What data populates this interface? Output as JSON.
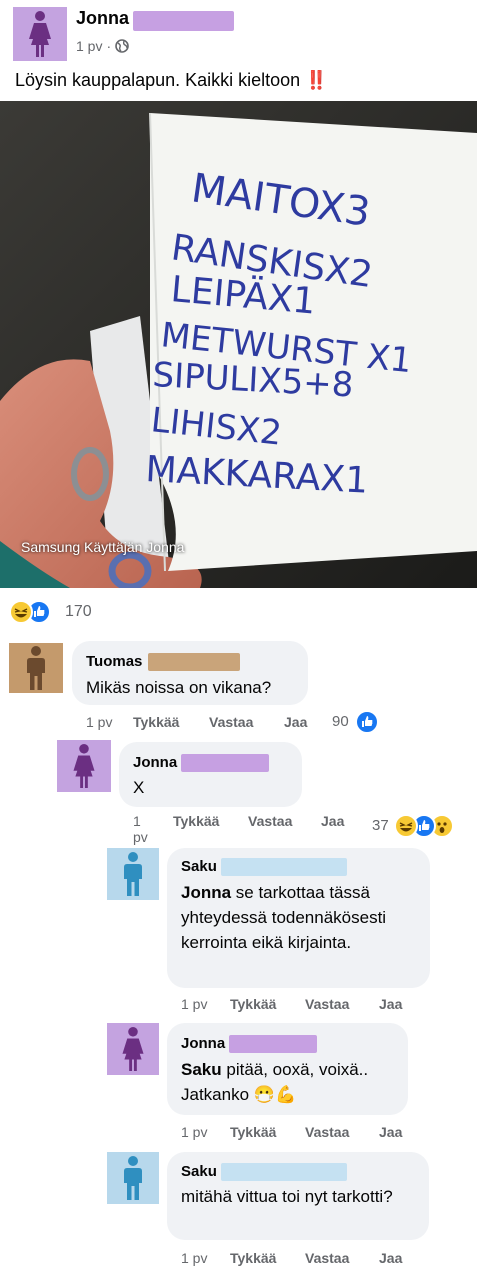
{
  "post": {
    "author": "Jonna",
    "time": "1 pv",
    "separator": "·",
    "text": "Löysin kauppalapun. Kaikki kieltoon",
    "text_emoji": "‼️",
    "photo_watermark": "Samsung Käyttäjän Jonna",
    "shopping_list": [
      "MAITOX3",
      "RANSKISX2",
      "LEIPÄX1",
      "METWURST X1",
      "SIPULIX5+8",
      "LIHISX2",
      "MAKKARAX1"
    ],
    "reaction_count": "170"
  },
  "comments": [
    {
      "author": "Tuomas",
      "text": "Mikäs noissa on vikana?",
      "time": "1 pv",
      "like": "Tykkää",
      "reply": "Vastaa",
      "share": "Jaa",
      "reactions": "90"
    },
    {
      "author": "Jonna",
      "text": "X",
      "time": "1 pv",
      "like": "Tykkää",
      "reply": "Vastaa",
      "share": "Jaa",
      "reactions": "37"
    },
    {
      "author": "Saku",
      "mention": "Jonna",
      "text": " se tarkottaa tässä yhteydessä todennäkösesti kerrointa eikä kirjainta.",
      "time": "1 pv",
      "like": "Tykkää",
      "reply": "Vastaa",
      "share": "Jaa"
    },
    {
      "author": "Jonna",
      "mention": "Saku",
      "text": " pitää, ooxä, voixä.. Jatkanko",
      "emoji": "😷💪",
      "time": "1 pv",
      "like": "Tykkää",
      "reply": "Vastaa",
      "share": "Jaa"
    },
    {
      "author": "Saku",
      "text": "mitähä vittua toi nyt tarkotti?",
      "time": "1 pv",
      "like": "Tykkää",
      "reply": "Vastaa",
      "share": "Jaa"
    }
  ],
  "colors": {
    "female_avatar_bg": "#c4a3e0",
    "female_figure": "#6b2f82",
    "male_tan_bg": "#c49a6c",
    "male_tan_figure": "#6b4a2e",
    "male_blue_bg": "#b7d8ec",
    "male_blue_figure": "#2f8fc0",
    "redact_purple": "#c6a0e2",
    "redact_tan": "#c9a47a",
    "redact_blue": "#c5e1f2",
    "like_blue": "#1877f2"
  },
  "icons": {
    "privacy": "globe-icon",
    "like": "like-thumb-icon",
    "haha": "haha-emoji-icon",
    "wow": "wow-emoji-icon"
  }
}
